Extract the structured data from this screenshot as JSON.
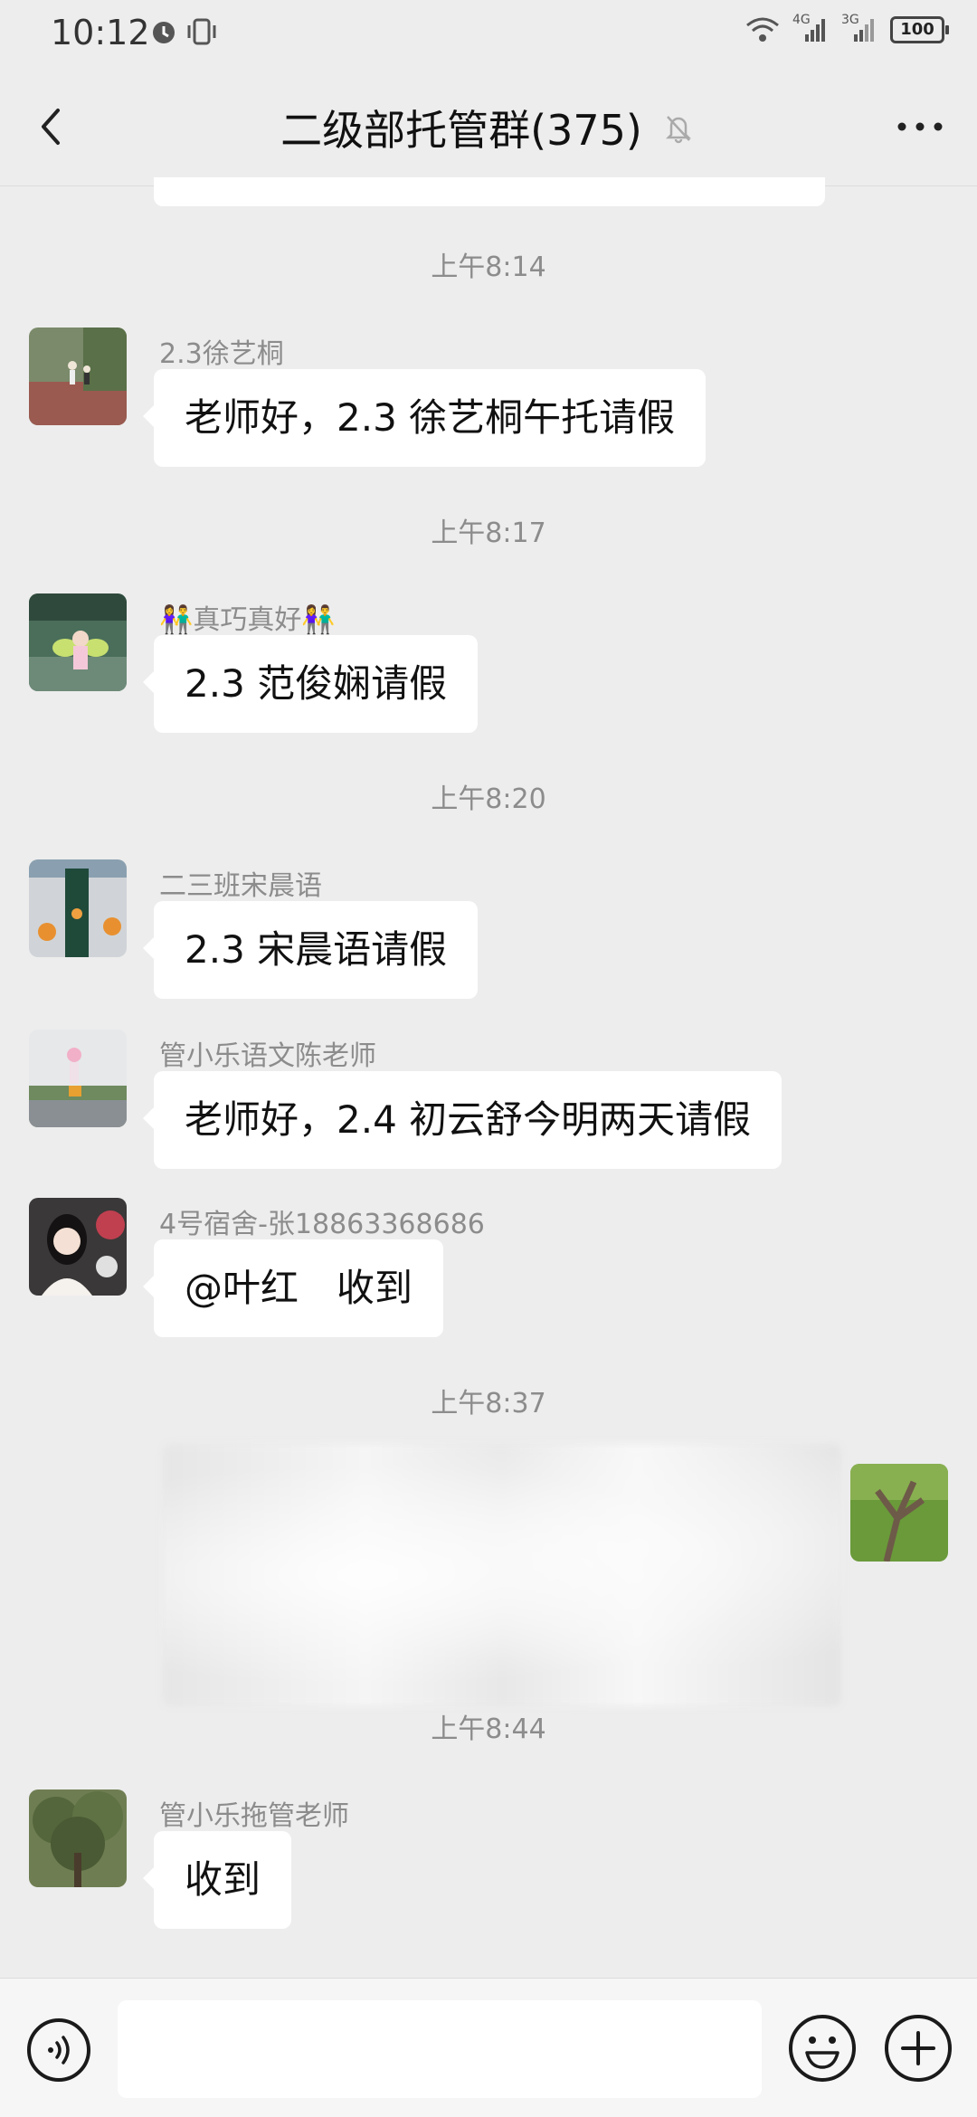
{
  "status": {
    "time": "10:12",
    "net_a": "4G",
    "net_b": "3G",
    "battery": "100"
  },
  "header": {
    "title": "二级部托管群(375)",
    "back_icon": "back-arrow-icon",
    "mute_icon": "bell-off-icon",
    "more_icon": "more-dots-icon"
  },
  "messages": {
    "t1": "上午8:14",
    "m1_sender": "2.3徐艺桐",
    "m1_text": "老师好，2.3 徐艺桐午托请假",
    "t2": "上午8:17",
    "m2_sender": "👫真巧真好👫",
    "m2_text": "2.3 范俊娴请假",
    "t3": "上午8:20",
    "m3_sender": "二三班宋晨语",
    "m3_text": "2.3 宋晨语请假",
    "m4_sender": "管小乐语文陈老师",
    "m4_text": "老师好，2.4 初云舒今明两天请假",
    "m5_sender": "4号宿舍-张18863368686",
    "m5_text": "@叶红　收到",
    "t4": "上午8:37",
    "t5": "上午8:44",
    "m6_sender": "管小乐拖管老师",
    "m6_text": "收到"
  },
  "input": {
    "value": "",
    "placeholder": ""
  },
  "colors": {
    "background": "#ededed",
    "bubble": "#ffffff",
    "meta_text": "#8c8c8c"
  }
}
